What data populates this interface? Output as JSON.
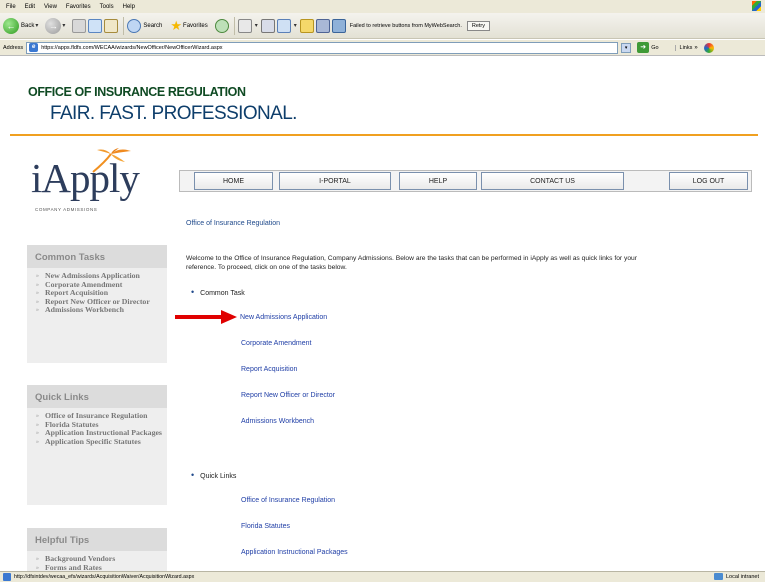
{
  "browser": {
    "menu": [
      "File",
      "Edit",
      "View",
      "Favorites",
      "Tools",
      "Help"
    ],
    "toolbar": {
      "back_label": "Back",
      "search_label": "Search",
      "favorites_label": "Favorites",
      "fail_message": "Failed to retrieve buttons from MyWebSearch.",
      "retry_label": "Retry"
    },
    "address": {
      "label": "Address",
      "url": "https://apps.fldfs.com/WECAA/wizards/NewOfficer/NewOfficerWizard.aspx",
      "go_label": "Go",
      "links_label": "Links"
    },
    "status": {
      "url": "http://dfsintdev/wecaa_efs/wizards/AcquisitionWaiver/AcquisitionWizard.aspx",
      "zone": "Local intranet"
    }
  },
  "header": {
    "org": "OFFICE OF INSURANCE REGULATION",
    "motto": "FAIR. FAST. PROFESSIONAL."
  },
  "logo": {
    "text": "iApply",
    "sub": "COMPANY ADMISSIONS"
  },
  "nav": {
    "home": "HOME",
    "portal": "I-PORTAL",
    "help": "HELP",
    "contact": "CONTACT US",
    "logout": "LOG OUT"
  },
  "sidebar": {
    "common": {
      "title": "Common Tasks",
      "items": [
        "New Admissions Application",
        "Corporate Amendment",
        "Report Acquisition",
        "Report New Officer or Director",
        "Admissions Workbench"
      ]
    },
    "quick": {
      "title": "Quick Links",
      "items": [
        "Office of Insurance Regulation",
        "Florida Statutes",
        "Application Instructional Packages",
        "Application Specific Statutes"
      ]
    },
    "tips": {
      "title": "Helpful Tips",
      "items": [
        "Background Vendors",
        "Forms and Rates"
      ]
    }
  },
  "main": {
    "crumb": "Office of Insurance Regulation",
    "welcome": "Welcome to the Office of Insurance Regulation, Company Admissions. Below are the tasks that can be performed in iApply as well as quick links for your reference. To proceed, click on one of the tasks below.",
    "common_heading": "Common Task",
    "tasks": [
      "New Admissions Application",
      "Corporate Amendment",
      "Report Acquisition",
      "Report New Officer or Director",
      "Admissions Workbench"
    ],
    "quick_heading": "Quick Links",
    "links": [
      "Office of Insurance Regulation",
      "Florida Statutes",
      "Application Instructional Packages"
    ]
  },
  "colors": {
    "org_green": "#0f4a23",
    "motto_blue": "#0e3e6b",
    "accent_orange": "#f0a020",
    "link_blue": "#1f3ea6",
    "arrow_red": "#e00000"
  }
}
